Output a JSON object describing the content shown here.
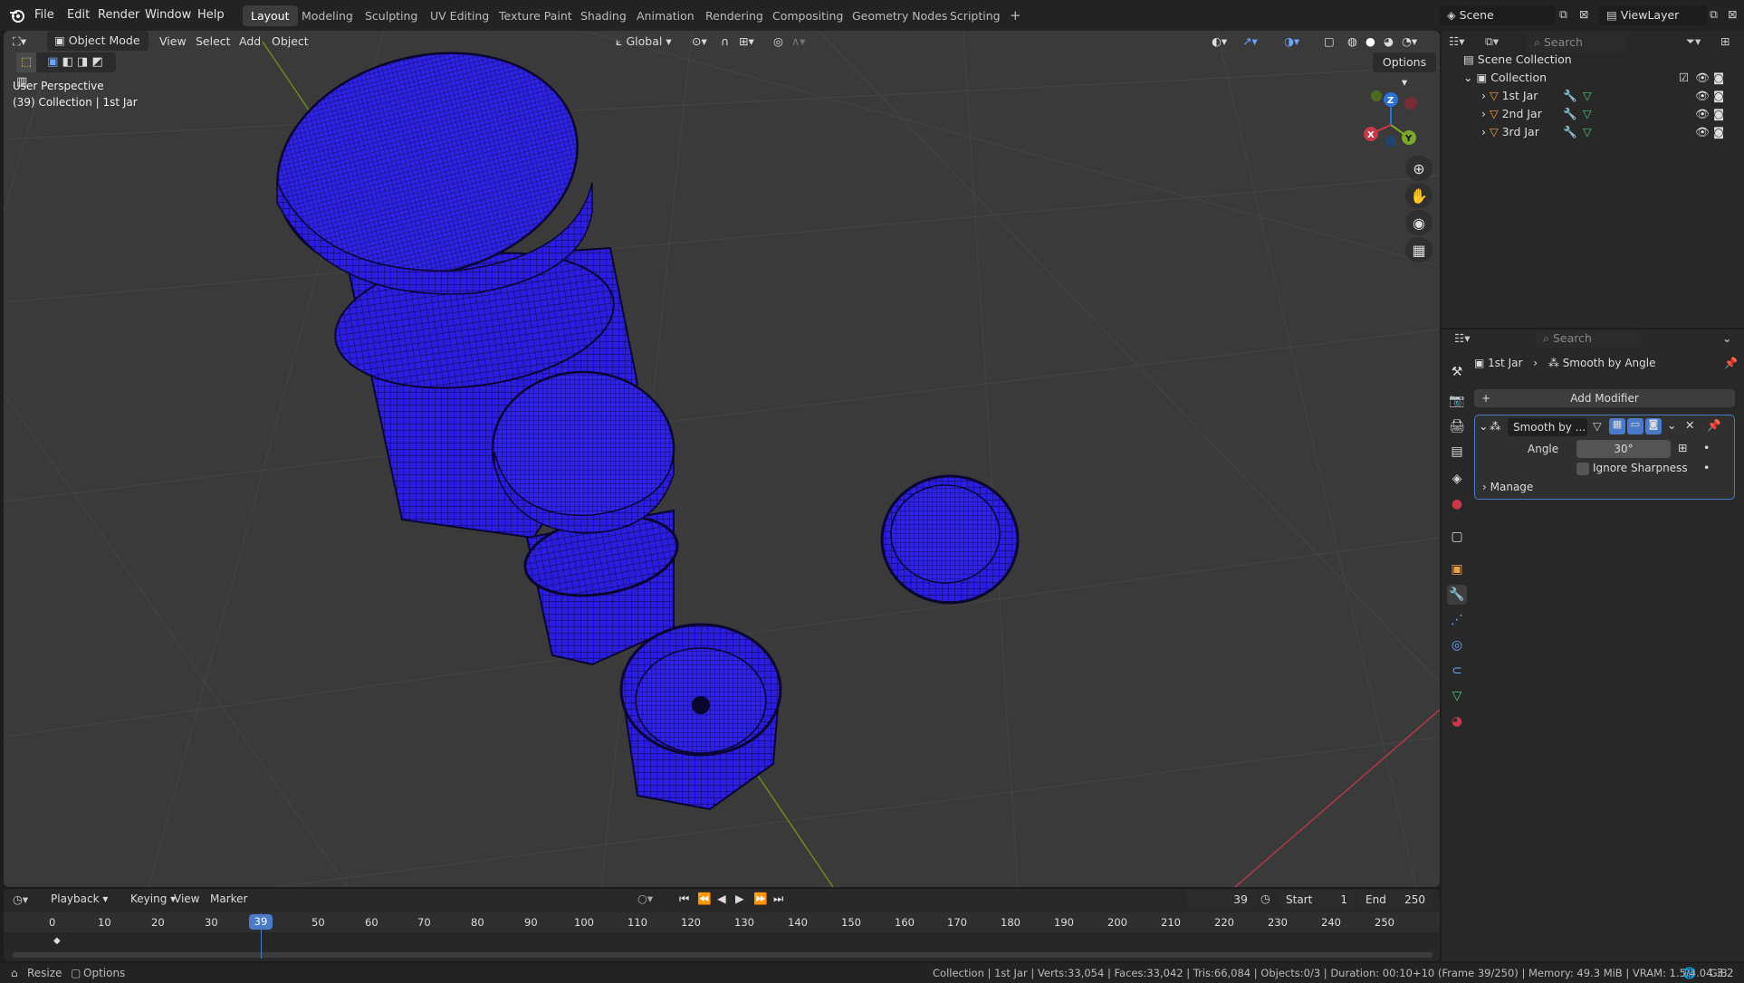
{
  "app": {
    "logo_icon": "blender-logo-icon"
  },
  "menu": [
    "File",
    "Edit",
    "Render",
    "Window",
    "Help"
  ],
  "workspaces": [
    "Layout",
    "Modeling",
    "Sculpting",
    "UV Editing",
    "Texture Paint",
    "Shading",
    "Animation",
    "Rendering",
    "Compositing",
    "Geometry Nodes",
    "Scripting"
  ],
  "active_workspace": "Layout",
  "scene": {
    "name": "Scene",
    "view_layer": "ViewLayer"
  },
  "viewport": {
    "mode": "Object Mode",
    "menus": [
      "View",
      "Select",
      "Add",
      "Object"
    ],
    "transform_orientation": "Global",
    "options_label": "Options",
    "overlay_title": "User Perspective",
    "overlay_subtitle": "(39) Collection | 1st Jar",
    "axis_labels": {
      "x": "X",
      "y": "Y",
      "z": "Z"
    },
    "colors": {
      "mesh": "#2a1de0",
      "x_axis": "#c8384a",
      "y_axis": "#7ba828",
      "z_axis": "#2a72d9"
    }
  },
  "outliner": {
    "search_placeholder": "Search",
    "scene_collection": "Scene Collection",
    "collection": "Collection",
    "items": [
      "1st Jar",
      "2nd Jar",
      "3rd Jar"
    ]
  },
  "properties": {
    "search_placeholder": "Search",
    "breadcrumb_object": "1st Jar",
    "breadcrumb_modifier": "Smooth by Angle",
    "add_modifier_label": "Add Modifier",
    "modifier_name": "Smooth by ...",
    "angle_label": "Angle",
    "angle_value": "30°",
    "ignore_sharpness_label": "Ignore Sharpness",
    "manage_label": "Manage"
  },
  "timeline": {
    "menus": [
      "Playback",
      "Keying",
      "View",
      "Marker"
    ],
    "current_frame": "39",
    "start_label": "Start",
    "start_value": "1",
    "end_label": "End",
    "end_value": "250",
    "ruler": [
      "0",
      "10",
      "20",
      "30",
      "39",
      "50",
      "60",
      "70",
      "80",
      "90",
      "100",
      "110",
      "120",
      "130",
      "140",
      "150",
      "160",
      "170",
      "180",
      "190",
      "200",
      "210",
      "220",
      "230",
      "240",
      "250"
    ]
  },
  "status": {
    "resize_label": "Resize",
    "options_label": "Options",
    "stats": "Collection | 1st Jar | Verts:33,054 | Faces:33,042 | Tris:66,084 | Objects:0/3 | Duration: 00:10+10 (Frame 39/250) | Memory: 49.3 MiB | VRAM: 1.5/4.0 GiB",
    "version": "4.3.2"
  }
}
